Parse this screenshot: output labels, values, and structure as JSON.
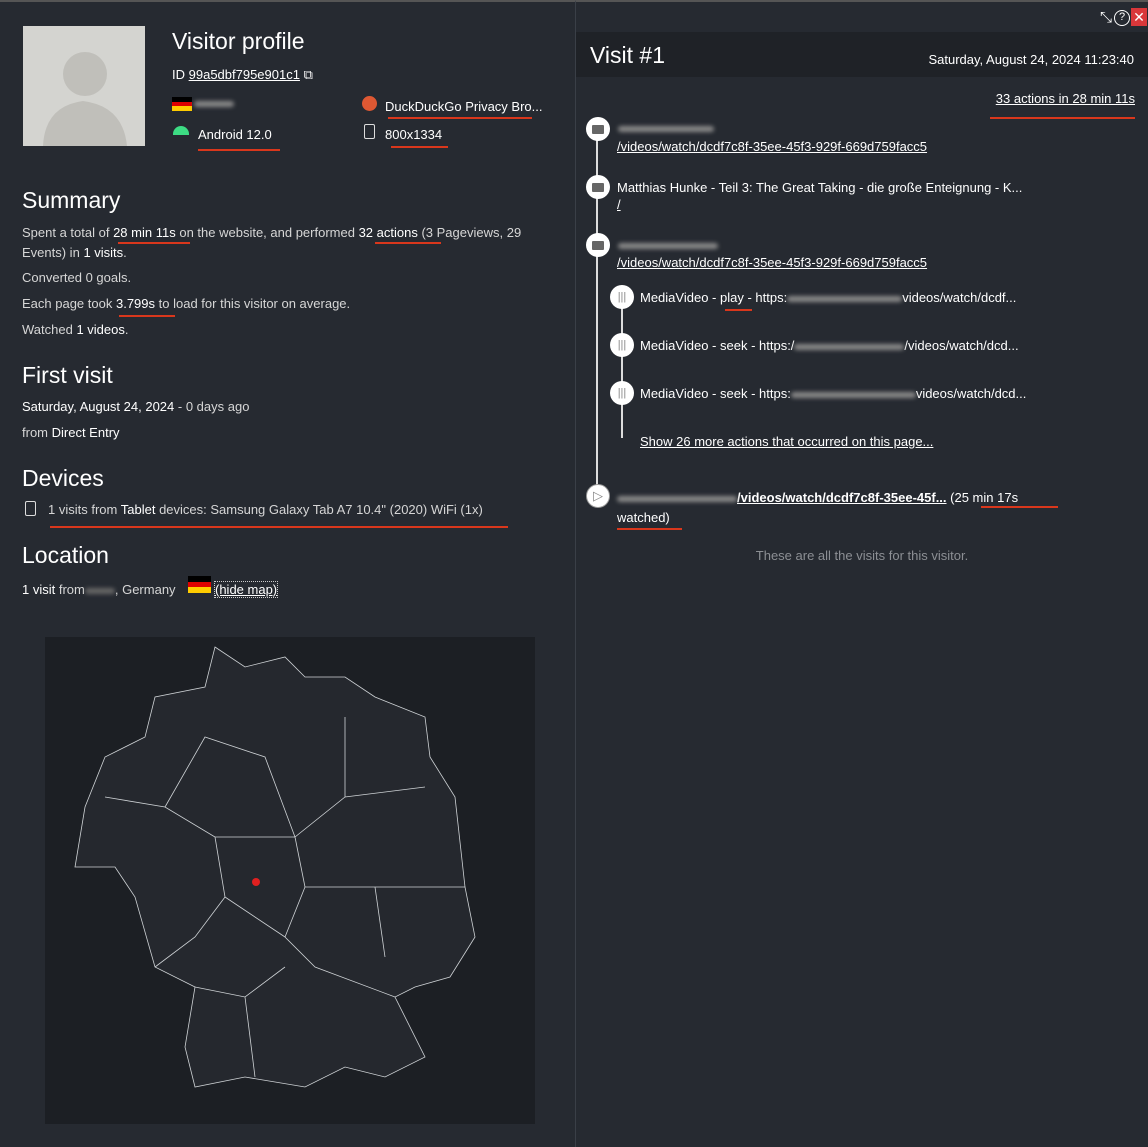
{
  "profile": {
    "title": "Visitor profile",
    "id_label": "ID",
    "id": "99a5dbf795e901c1",
    "browser": "DuckDuckGo Privacy Bro...",
    "os": "Android 12.0",
    "resolution": "800x1334"
  },
  "summary": {
    "title": "Summary",
    "t1": "Spent a total of",
    "duration": "28 min 11s",
    "t2": "on the website, and performed",
    "actions": "32 actions",
    "t3": "(3 Pageviews, 29 Events) in",
    "visits": "1 visits",
    "t4": ".",
    "goals": "Converted 0 goals.",
    "load1": "Each page took",
    "load_time": "3.799s",
    "load2": "to load for this visitor on average.",
    "watched1": "Watched",
    "watched_count": "1 videos",
    "watched2": "."
  },
  "first_visit": {
    "title": "First visit",
    "date": "Saturday, August 24, 2024",
    "ago": "- 0 days ago",
    "from": "from",
    "source": "Direct Entry"
  },
  "devices": {
    "title": "Devices",
    "count": "1 visits from",
    "type": "Tablet",
    "rest": "devices: Samsung Galaxy Tab A7 10.4\" (2020) WiFi (1x)"
  },
  "location": {
    "title": "Location",
    "visit": "1 visit",
    "from": "from",
    "country": ", Germany",
    "hide_map": "(hide map)"
  },
  "visit": {
    "title": "Visit #1",
    "datetime": "Saturday, August 24, 2024 11:23:40",
    "summary": "33 actions in 28 min 11s",
    "actions": [
      {
        "url": "/videos/watch/dcdf7c8f-35ee-45f3-929f-669d759facc5"
      },
      {
        "title": "Matthias Hunke - Teil 3: The Great Taking - die große Enteignung - K...",
        "url": "/"
      },
      {
        "url": "/videos/watch/dcdf7c8f-35ee-45f3-929f-669d759facc5"
      }
    ],
    "events": [
      {
        "a": "MediaVideo - ",
        "b": "play",
        "c": " - https:",
        "d": "videos/watch/dcdf..."
      },
      {
        "a": "MediaVideo - ",
        "b": "seek",
        "c": " - https:/",
        "d": "/videos/watch/dcd..."
      },
      {
        "a": "MediaVideo - ",
        "b": "seek",
        "c": " - https:",
        "d": "videos/watch/dcd..."
      }
    ],
    "more": "Show 26 more actions that occurred on this page...",
    "video_url": "/videos/watch/dcdf7c8f-35ee-45f3-929f-669d759facc5",
    "video_url_short": "/videos/watch/dcdf7c8f-35ee-45f...",
    "watched1": "(25 min 17s",
    "watched2": "watched)",
    "end": "These are all the visits for this visitor."
  },
  "colors": {
    "bg": "#262a31",
    "header": "#1f2227",
    "annotation": "#d9371c",
    "close": "#d9373a",
    "marker": "#e02020"
  }
}
